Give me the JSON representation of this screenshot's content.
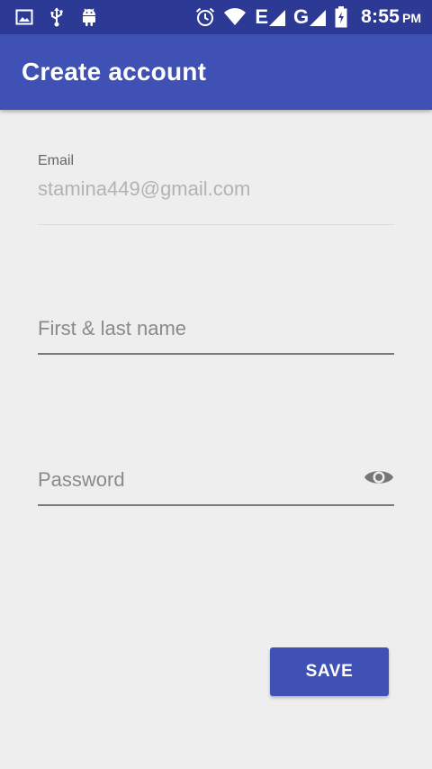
{
  "status_bar": {
    "time": "8:55",
    "ampm": "PM",
    "network_e": "E",
    "network_g": "G",
    "icons": [
      "image-icon",
      "usb-icon",
      "android-icon",
      "alarm-icon",
      "wifi-icon",
      "signal-icon",
      "signal-icon",
      "battery-charging-icon"
    ]
  },
  "app_bar": {
    "title": "Create account"
  },
  "form": {
    "email_label": "Email",
    "email_value": "stamina449@gmail.com",
    "name_placeholder": "First & last name",
    "name_value": "",
    "password_placeholder": "Password",
    "password_value": ""
  },
  "actions": {
    "save_label": "SAVE"
  },
  "colors": {
    "status_bar": "#2c3a96",
    "primary": "#3f51b5",
    "background": "#eeeeee"
  }
}
